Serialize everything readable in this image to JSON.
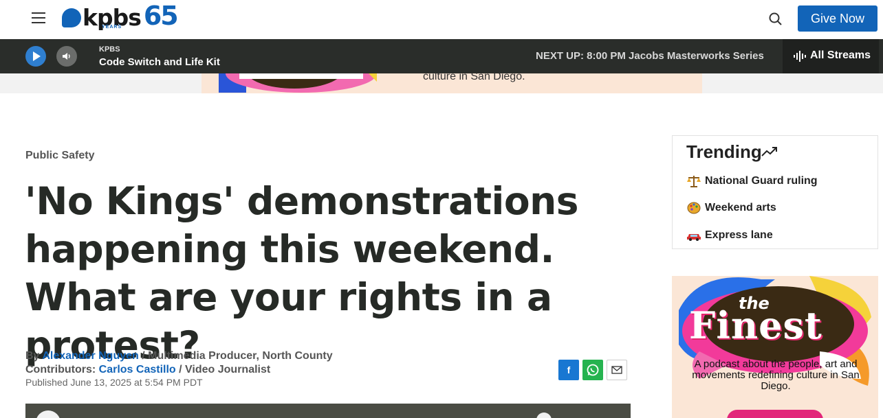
{
  "header": {
    "logo_text": "kpbs",
    "logo_number": "65",
    "logo_years": "YEARS",
    "give_label": "Give Now"
  },
  "player": {
    "station": "KPBS",
    "show": "Code Switch and Life Kit",
    "next_up": "NEXT UP: 8:00 PM Jacobs Masterworks Series",
    "streams_label": "All Streams"
  },
  "top_ad": {
    "text": "culture in San Diego."
  },
  "article": {
    "category": "Public Safety",
    "headline": "'No Kings' demonstrations happening this weekend. What are your rights in a protest?",
    "byline_prefix": "By ",
    "author": "Alexander Nguyen",
    "author_role": " / Multimedia Producer, North County",
    "contributors_prefix": "Contributors: ",
    "contributor": "Carlos Castillo",
    "contributor_role": " / Video Journalist",
    "published": "Published June 13, 2025 at 5:54 PM PDT"
  },
  "share": {
    "facebook_glyph": "f"
  },
  "trending": {
    "title": "Trending",
    "items": [
      {
        "label": "National Guard ruling",
        "icon": "scales-icon"
      },
      {
        "label": "Weekend arts",
        "icon": "palette-icon"
      },
      {
        "label": "Express lane",
        "icon": "car-icon"
      }
    ]
  },
  "side_ad": {
    "the": "the",
    "finest": "Finest",
    "text": "A podcast about the people, art and movements redefining culture in San Diego."
  },
  "colors": {
    "brand_blue": "#1264b8",
    "player_bg": "#2a2d2a",
    "ad_bg": "#fbe6d6"
  }
}
